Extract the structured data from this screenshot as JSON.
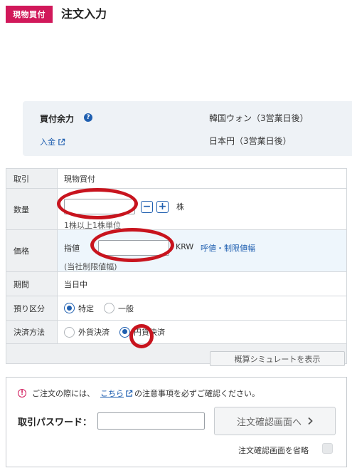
{
  "header": {
    "tag": "現物買付",
    "title": "注文入力"
  },
  "balance": {
    "title": "買付余力",
    "help_icon": "question-circle-icon",
    "deposit_link": "入金",
    "currencies": [
      "韓国ウォン（3営業日後）",
      "日本円（3営業日後）"
    ]
  },
  "form": {
    "rows": {
      "torihiki": {
        "label": "取引",
        "value": "現物買付"
      },
      "quantity": {
        "label": "数量",
        "unit": "株",
        "note": "1株以上1株単位",
        "value": ""
      },
      "price": {
        "label": "価格",
        "type": "指値",
        "currency": "KRW",
        "tick_link": "呼値・制限値幅",
        "note": "(当社制限値幅)",
        "value": ""
      },
      "period": {
        "label": "期間",
        "value": "当日中"
      },
      "account": {
        "label": "預り区分",
        "options": [
          "特定",
          "一般"
        ],
        "selected": "特定"
      },
      "settlement": {
        "label": "決済方法",
        "options": [
          "外貨決済",
          "円貨決済"
        ],
        "selected": "円貨決済"
      }
    },
    "simulate_button": "概算シミュレートを表示"
  },
  "confirm": {
    "notice_pre": "ご注文の際には、",
    "notice_link": "こちら",
    "notice_post": "の注意事項を必ずご確認ください。",
    "password_label": "取引パスワード：",
    "password_value": "",
    "confirm_button": "注文確認画面へ",
    "skip_label": "注文確認画面を省略",
    "skip_checked": false
  },
  "colors": {
    "accent": "#d1185a",
    "link": "#1f5fb0",
    "highlight_ring": "#c8141e"
  }
}
